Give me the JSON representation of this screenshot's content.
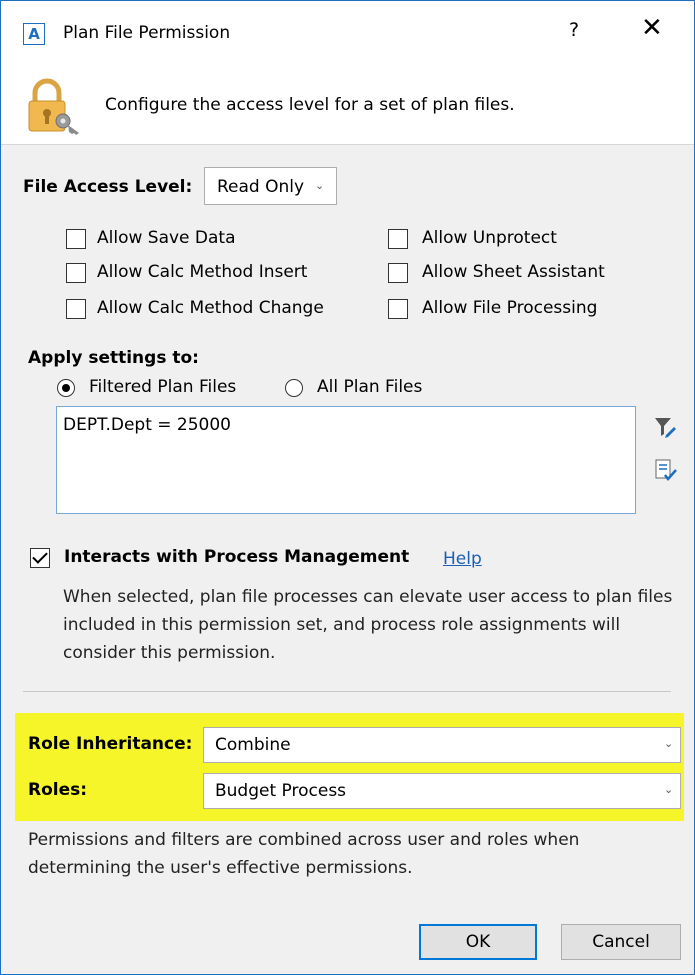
{
  "window": {
    "app_icon_letter": "A",
    "title": "Plan File Permission",
    "help_label": "?",
    "close_label": "✕"
  },
  "header": {
    "description": "Configure the access level for a set of plan files.",
    "icon": "lock-key-icon"
  },
  "access": {
    "label": "File Access Level:",
    "selected": "Read Only"
  },
  "options": [
    {
      "label": "Allow Save Data",
      "checked": false
    },
    {
      "label": "Allow Calc Method Insert",
      "checked": false
    },
    {
      "label": "Allow Calc Method Change",
      "checked": false
    },
    {
      "label": "Allow Unprotect",
      "checked": false
    },
    {
      "label": "Allow Sheet Assistant",
      "checked": false
    },
    {
      "label": "Allow File Processing",
      "checked": false
    }
  ],
  "apply": {
    "label": "Apply settings to:",
    "filtered_label": "Filtered Plan Files",
    "all_label": "All Plan Files",
    "selected": "Filtered Plan Files",
    "filter_text": "DEPT.Dept = 25000"
  },
  "process": {
    "label": "Interacts with Process Management",
    "checked": true,
    "help_link": "Help",
    "description": "When selected, plan file processes can elevate user access to plan files included in this permission set, and process role assignments will consider this permission."
  },
  "roles": {
    "inheritance_label": "Role Inheritance:",
    "inheritance_value": "Combine",
    "roles_label": "Roles:",
    "roles_value": "Budget Process",
    "info": "Permissions and filters are combined across user and roles when determining the user's effective permissions."
  },
  "buttons": {
    "ok": "OK",
    "cancel": "Cancel"
  },
  "colors": {
    "highlight": "#f5f52a",
    "accent": "#0078d7",
    "link": "#1a5fb4"
  }
}
